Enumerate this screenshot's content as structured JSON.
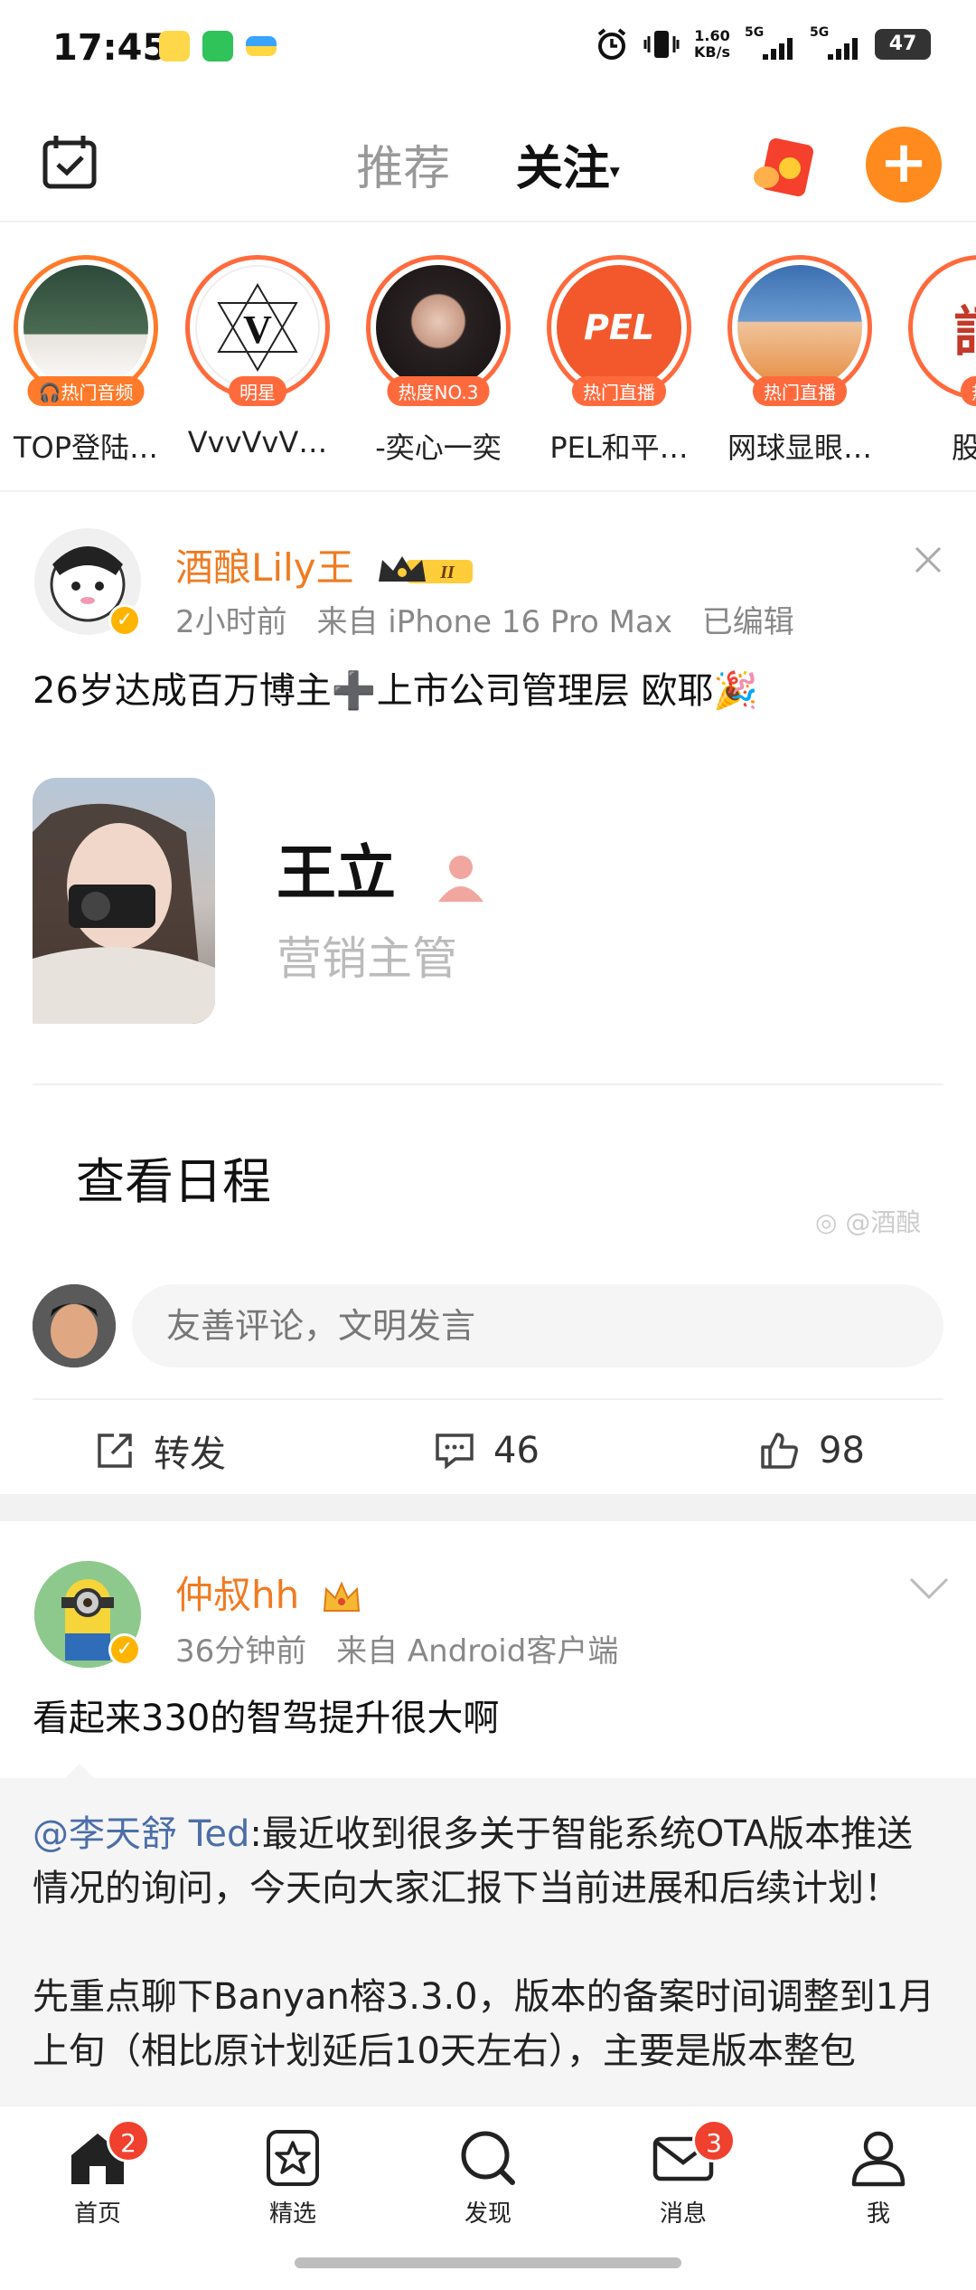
{
  "status_bar": {
    "time": "17:45",
    "net_speed_value": "1.60",
    "net_speed_unit": "KB/s",
    "signal1_label": "5G",
    "signal2_label": "5G",
    "battery": "47"
  },
  "top_nav": {
    "tabs": [
      {
        "label": "推荐",
        "active": false
      },
      {
        "label": "关注",
        "active": true
      }
    ],
    "caret": "▾",
    "accent_color": "#ff8a1d"
  },
  "stories": [
    {
      "badge": "🎧热门音频",
      "name": "TOP登陆…"
    },
    {
      "badge": "明星",
      "name": "VvvVvV…"
    },
    {
      "badge": "热度NO.3",
      "name": "-奕心一奕"
    },
    {
      "badge": "热门直播",
      "name": "PEL和平…",
      "logo": "PEL"
    },
    {
      "badge": "热门直播",
      "name": "网球显眼…"
    },
    {
      "badge": "热",
      "name": "股盗"
    }
  ],
  "post1": {
    "author": "酒酿Lily王",
    "rank_badge": "II",
    "time": "2小时前",
    "source": "来自 iPhone 16 Pro Max",
    "edited": "已编辑",
    "text": "26岁达成百万博主➕上市公司管理层 欧耶🎉",
    "card": {
      "name": "王立",
      "title": "营销主管",
      "link": "查看日程",
      "watermark": "@酒酿"
    },
    "comment_placeholder": "友善评论，文明发言",
    "actions": {
      "repost": "转发",
      "comments": "46",
      "likes": "98"
    }
  },
  "post2": {
    "author": "仲叔hh",
    "time": "36分钟前",
    "source": "来自 Android客户端",
    "text": "看起来330的智驾提升很大啊",
    "repost": {
      "mention": "@李天舒 Ted",
      "para1": ":最近收到很多关于智能系统OTA版本推送情况的询问，今天向大家汇报下当前进展和后续计划！",
      "para2": "先重点聊下Banyan榕3.3.0，版本的备案时间调整到1月上旬（相比原计划延后10天左右），主要是版本整包"
    }
  },
  "tab_bar": {
    "tabs": [
      {
        "label": "首页",
        "badge": "2"
      },
      {
        "label": "精选",
        "badge": ""
      },
      {
        "label": "发现",
        "badge": ""
      },
      {
        "label": "消息",
        "badge": "3"
      },
      {
        "label": "我",
        "badge": ""
      }
    ]
  }
}
